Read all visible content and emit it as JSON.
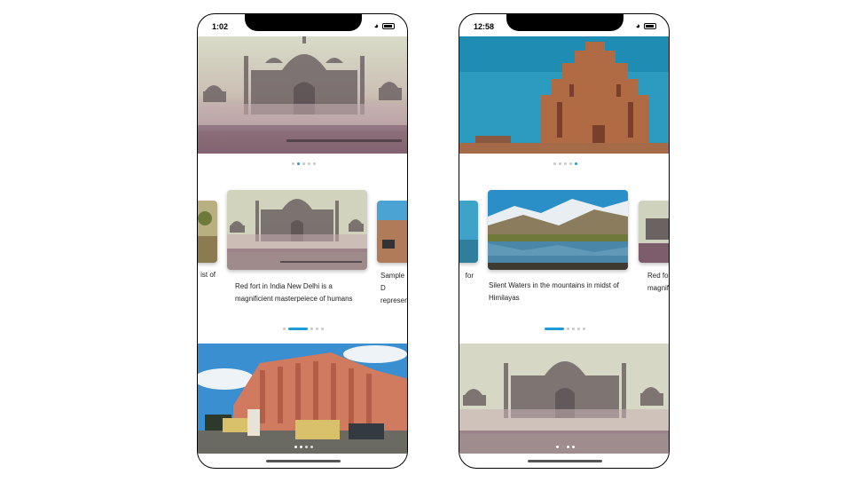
{
  "left_phone": {
    "time": "1:02",
    "top_dots": [
      false,
      true,
      false,
      false,
      false
    ],
    "captions": {
      "prev_partial": "ist of",
      "current": "Red fort in India New Delhi is a magnificient masterpeiece of humans",
      "next_partial": "Sample D represen"
    },
    "pager": {
      "active_index": 0,
      "dot_count": 4
    },
    "bottom_dots": [
      true,
      true,
      false,
      false
    ]
  },
  "right_phone": {
    "time": "12:58",
    "top_dots": [
      false,
      false,
      false,
      false,
      true
    ],
    "captions": {
      "prev_partial": "for",
      "current": "Silent Waters in the mountains in midst of Himilayas",
      "next_partial": "Red fo magnifi"
    },
    "pager": {
      "active_index": 0,
      "dot_count": 4
    },
    "bottom_dots": [
      true,
      false,
      true,
      true
    ]
  },
  "colors": {
    "accent": "#1e9bd7",
    "inactive_dot": "#c8c8c8"
  }
}
